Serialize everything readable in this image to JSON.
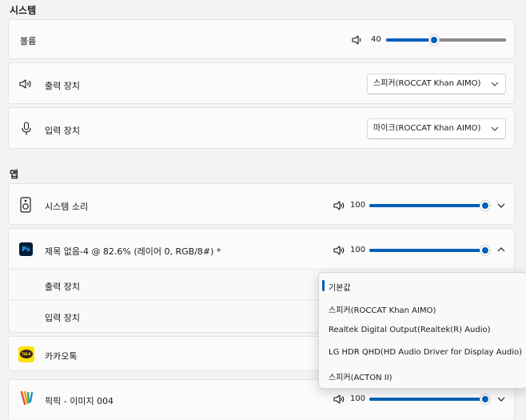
{
  "system": {
    "section_title": "시스템",
    "volume": {
      "label": "볼륨",
      "value": "40",
      "level": 0.4
    },
    "output": {
      "label": "출력 장치",
      "selected": "스피커(ROCCAT Khan AIMO)"
    },
    "input": {
      "label": "입력 장치",
      "selected": "마이크(ROCCAT Khan AIMO)"
    }
  },
  "apps": {
    "section_title": "앱",
    "items": [
      {
        "name": "시스템 소리",
        "volume": "100",
        "level": 1.0,
        "icon": "speaker-device-icon"
      },
      {
        "name": "제목 없음-4 @ 82.6% (레이어 0, RGB/8#) *",
        "volume": "100",
        "level": 1.0,
        "icon": "photoshop-icon",
        "app_icon_text": "Ps",
        "sub_rows": {
          "output_label": "출력 장치",
          "input_label": "입력 장치"
        }
      },
      {
        "name": "카카오톡",
        "icon": "kakaotalk-icon",
        "app_icon_text": "TALK"
      },
      {
        "name": "픽픽 - 이미지 004",
        "volume": "100",
        "level": 1.0,
        "icon": "picpick-icon"
      }
    ]
  },
  "dropdown": {
    "selected_index": 0,
    "options": [
      "기본값",
      "스피커(ROCCAT Khan AIMO)",
      "Realtek Digital Output(Realtek(R) Audio)",
      "LG HDR QHD(HD Audio Driver for Display Audio)",
      "스피커(ACTON II)"
    ]
  },
  "colors": {
    "accent": "#005fb8",
    "photoshop_bg": "#001e36",
    "photoshop_fg": "#31a8ff",
    "kakao_bg": "#fae100"
  }
}
